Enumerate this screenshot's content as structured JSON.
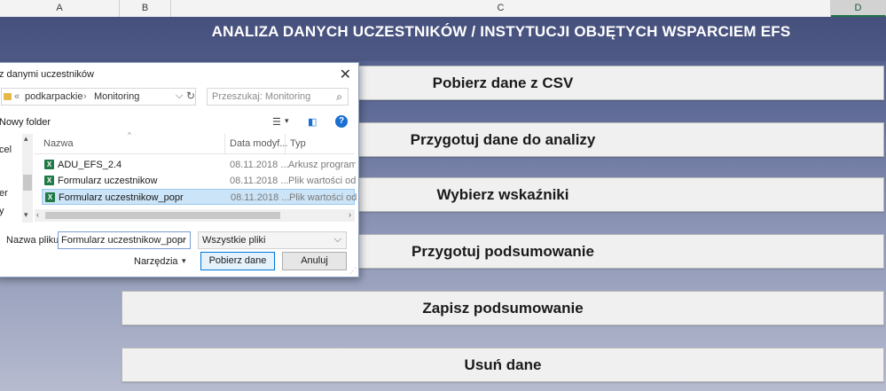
{
  "spreadsheet": {
    "columns": [
      "A",
      "B",
      "C",
      "D"
    ],
    "selected_column": "D",
    "title": "ANALIZA DANYCH UCZESTNIKÓW / INSTYTUCJI OBJĘTYCH WSPARCIEM EFS",
    "buttons": [
      "Pobierz dane z CSV",
      "Przygotuj dane do analizy",
      "Wybierz wskaźniki",
      "Przygotuj podsumowanie",
      "Zapisz podsumowanie",
      "Usuń dane"
    ]
  },
  "dialog": {
    "title": "z danymi uczestników",
    "close": "✕",
    "address": {
      "separator": "«",
      "path": [
        "podkarpackie",
        "Monitoring"
      ],
      "arrow": "›",
      "dropdown": "⌵",
      "refresh": "↻"
    },
    "search_placeholder": "Przeszukaj: Monitoring",
    "search_icon": "⌕",
    "new_folder": "Nowy folder",
    "view_icon": "☰",
    "view_caret": "▾",
    "pane_icon": "◧",
    "help_icon": "?",
    "nav_items": [
      "cel",
      "er",
      "y"
    ],
    "scroll": {
      "up": "▴",
      "down": "▾",
      "left": "‹",
      "right": "›",
      "sort": "^"
    },
    "columns": {
      "name": "Nazwa",
      "date": "Data modyf...",
      "type": "Typ"
    },
    "files": [
      {
        "name": "ADU_EFS_2.4",
        "date": "08.11.2018 ...",
        "type": "Arkusz programu"
      },
      {
        "name": "Formularz uczestnikow",
        "date": "08.11.2018 ...",
        "type": "Plik wartości odd"
      },
      {
        "name": "Formularz uczestnikow_popr",
        "date": "08.11.2018 ...",
        "type": "Plik wartości odd"
      }
    ],
    "selected_file_index": 2,
    "filename_label": "Nazwa pliku:",
    "filename_value": "Formularz uczestnikow_popr",
    "filter_value": "Wszystkie pliki",
    "tools_label": "Narzędzia",
    "tools_caret": "▾",
    "ok_label": "Pobierz dane",
    "cancel_label": "Anuluj",
    "xl_icon": "X",
    "grip": "⋰"
  }
}
